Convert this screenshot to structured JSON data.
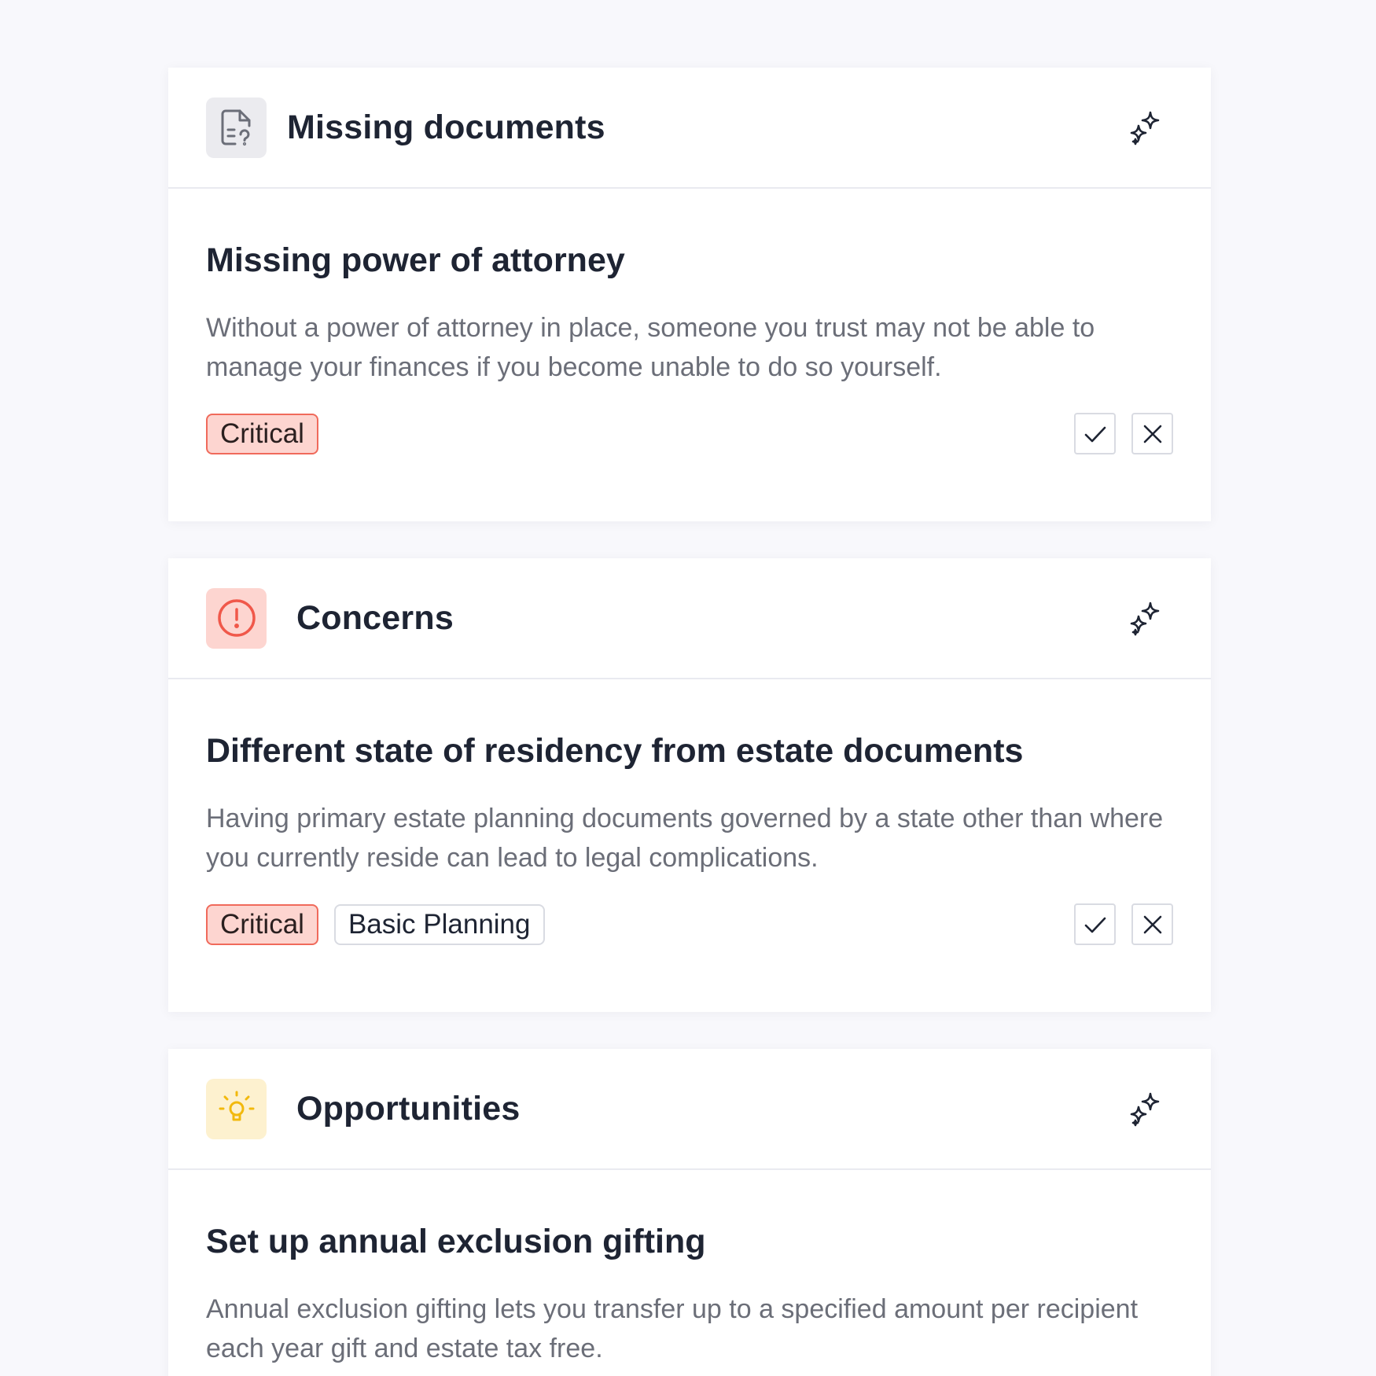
{
  "sections": [
    {
      "title": "Missing documents",
      "icon": "document-question-icon",
      "icon_bg": "#ebebef",
      "icon_color": "#6b6e78",
      "action_icon": "sparkle-icon",
      "item": {
        "title": "Missing power of attorney",
        "description": "Without a power of attorney in place, someone you trust may not be able to manage your finances if you become unable to do so yourself.",
        "tags": [
          "Critical"
        ],
        "accept_icon": "check-icon",
        "dismiss_icon": "close-icon"
      }
    },
    {
      "title": "Concerns",
      "icon": "alert-circle-icon",
      "icon_bg": "#fdd5d0",
      "icon_color": "#f0584a",
      "action_icon": "sparkle-icon",
      "item": {
        "title": "Different state of residency from estate documents",
        "description": "Having primary estate planning documents governed by a state other than where you currently reside can lead to legal complications.",
        "tags": [
          "Critical",
          "Basic Planning"
        ],
        "accept_icon": "check-icon",
        "dismiss_icon": "close-icon"
      }
    },
    {
      "title": "Opportunities",
      "icon": "lightbulb-icon",
      "icon_bg": "#fdf1cf",
      "icon_color": "#f2b90d",
      "action_icon": "sparkle-icon",
      "item": {
        "title": "Set up annual exclusion gifting",
        "description": "Annual exclusion gifting lets you transfer up to a specified amount per recipient each year gift and estate tax free."
      }
    }
  ],
  "colors": {
    "background": "#f8f8fc",
    "critical_bg": "#fdd5d0",
    "critical_border": "#f06a5b",
    "text_primary": "#1e2433",
    "text_secondary": "#6b6e78"
  }
}
